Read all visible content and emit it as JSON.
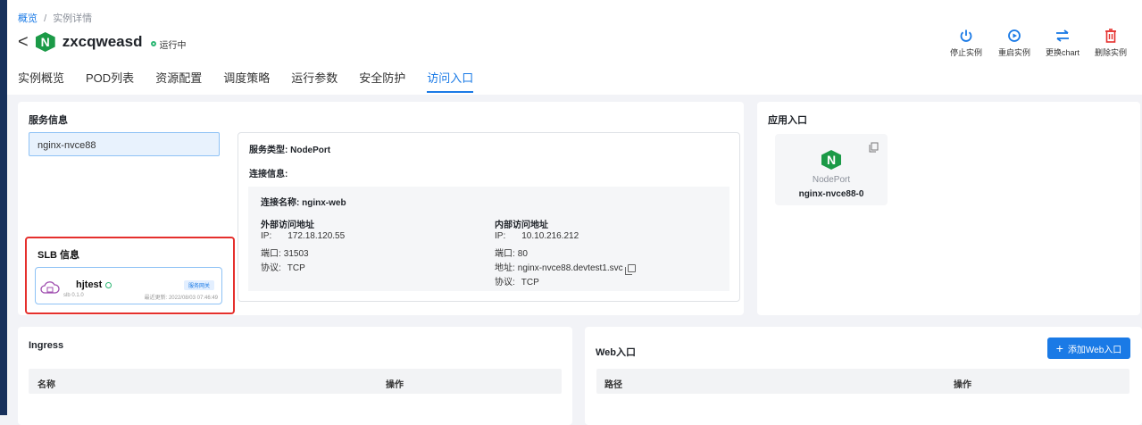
{
  "breadcrumb": {
    "home": "概览",
    "separator": "/",
    "current": "实例详情"
  },
  "header": {
    "back": "<",
    "logo_letter": "N",
    "app_name": "zxcqweasd",
    "status": "运行中"
  },
  "actions": [
    {
      "label": "停止实例",
      "icon": "power-icon"
    },
    {
      "label": "重启实例",
      "icon": "restart-icon"
    },
    {
      "label": "更换chart",
      "icon": "swap-icon"
    },
    {
      "label": "删除实例",
      "icon": "trash-icon"
    }
  ],
  "tabs": [
    "实例概览",
    "POD列表",
    "资源配置",
    "调度策略",
    "运行参数",
    "安全防护",
    "访问入口"
  ],
  "active_tab": "访问入口",
  "service_info": {
    "title": "服务信息",
    "selected_service": "nginx-nvce88",
    "service_type": "服务类型: NodePort",
    "conn_label": "连接信息:",
    "conn_name": "连接名称: nginx-web",
    "external": {
      "title": "外部访问地址",
      "ip_label": "IP:",
      "ip": "172.18.120.55",
      "port_label": "端口:",
      "port": "31503",
      "protocol_label": "协议:",
      "protocol": "TCP"
    },
    "internal": {
      "title": "内部访问地址",
      "ip_label": "IP:",
      "ip": "10.10.216.212",
      "port_label": "端口:",
      "port": "80",
      "addr_label": "地址:",
      "addr": "nginx-nvce88.devtest1.svc",
      "protocol_label": "协议:",
      "protocol": "TCP"
    }
  },
  "slb": {
    "title": "SLB 信息",
    "name": "hjtest",
    "version": "slb 0.1.0",
    "badge": "服务网关",
    "updated": "最近更新: 2022/08/03 07:46:49"
  },
  "app_entry": {
    "title": "应用入口",
    "type": "NodePort",
    "name": "nginx-nvce88-0"
  },
  "ingress": {
    "title": "Ingress",
    "col_name": "名称",
    "col_op": "操作"
  },
  "web_entry": {
    "title": "Web入口",
    "add_button": "添加Web入口",
    "col_path": "路径",
    "col_op": "操作"
  },
  "colors": {
    "primary": "#1a7ae6",
    "success": "#2bb673",
    "danger": "#e5302d",
    "nginx": "#1b9a47"
  }
}
